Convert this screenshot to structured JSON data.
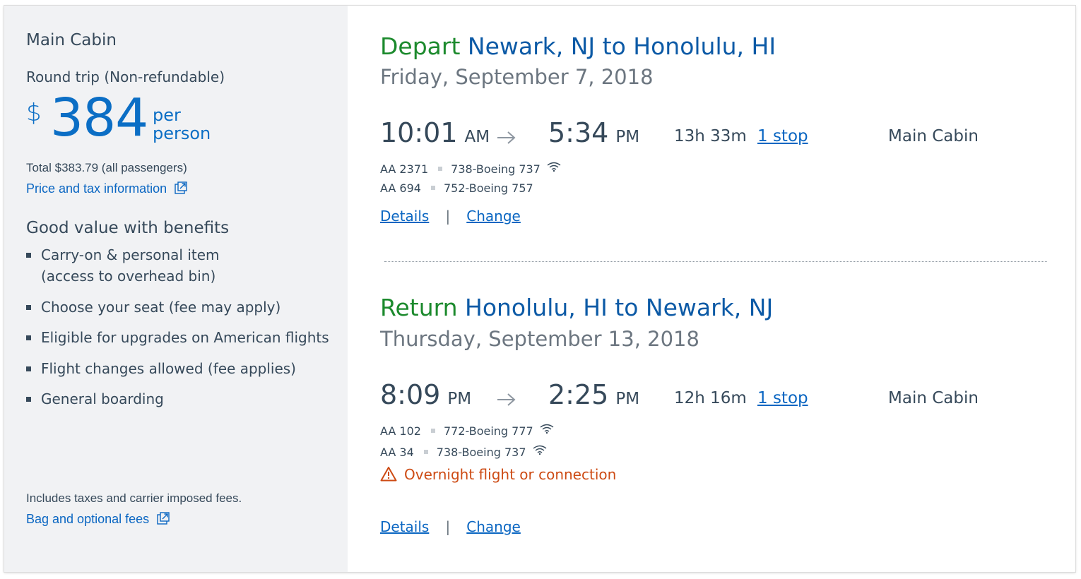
{
  "sidebar": {
    "cabin": "Main Cabin",
    "trip_type": "Round trip (Non-refundable)",
    "currency": "$",
    "price": "384",
    "per_line1": "per",
    "per_line2": "person",
    "total": "Total $383.79 (all passengers)",
    "price_tax_link": "Price and tax information",
    "benefits_title": "Good value with benefits",
    "benefits": [
      {
        "line1": "Carry-on & personal item",
        "line2": "(access to overhead bin)"
      },
      {
        "line1": "Choose your seat (fee may apply)"
      },
      {
        "line1": "Eligible for upgrades on American flights"
      },
      {
        "line1": "Flight changes allowed (fee applies)"
      },
      {
        "line1": "General boarding"
      }
    ],
    "includes_note": "Includes taxes and carrier imposed fees.",
    "bag_link": "Bag and optional fees"
  },
  "colors": {
    "sidebar_bg": "#f1f2f4",
    "accent_blue": "#0b6ec5",
    "link_blue": "#0a66c2",
    "direction_green": "#1c8a2d",
    "route_blue": "#0c5aa6",
    "warning_orange": "#cd4b14",
    "text": "#36495a",
    "date_gray": "#6c7680"
  },
  "depart": {
    "direction": "Depart",
    "route": "Newark, NJ to Honolulu, HI",
    "date": "Friday, September 7, 2018",
    "dep_time": "10:01",
    "dep_ampm": "AM",
    "arr_time": "5:34",
    "arr_ampm": "PM",
    "duration_h": "13h",
    "duration_m": "33m",
    "stops": "1 stop",
    "cabin": "Main Cabin",
    "legs": [
      {
        "flight": "AA 2371",
        "aircraft": "738-Boeing 737",
        "wifi": true
      },
      {
        "flight": "AA 694",
        "aircraft": "752-Boeing 757",
        "wifi": false
      }
    ],
    "details": "Details",
    "separator": "|",
    "change": "Change"
  },
  "return": {
    "direction": "Return",
    "route": "Honolulu, HI to Newark, NJ",
    "date": "Thursday, September 13, 2018",
    "dep_time": "8:09",
    "dep_ampm": "PM",
    "arr_time": "2:25",
    "arr_ampm": "PM",
    "duration_h": "12h",
    "duration_m": "16m",
    "stops": "1 stop",
    "cabin": "Main Cabin",
    "legs": [
      {
        "flight": "AA 102",
        "aircraft": "772-Boeing 777",
        "wifi": true
      },
      {
        "flight": "AA 34",
        "aircraft": "738-Boeing 737",
        "wifi": true
      }
    ],
    "warning": "Overnight flight or connection",
    "details": "Details",
    "separator": "|",
    "change": "Change"
  },
  "icons": {
    "arrow": "right-arrow-icon",
    "wifi": "wifi-icon",
    "external": "external-link-icon",
    "warning": "warning-triangle-icon"
  }
}
